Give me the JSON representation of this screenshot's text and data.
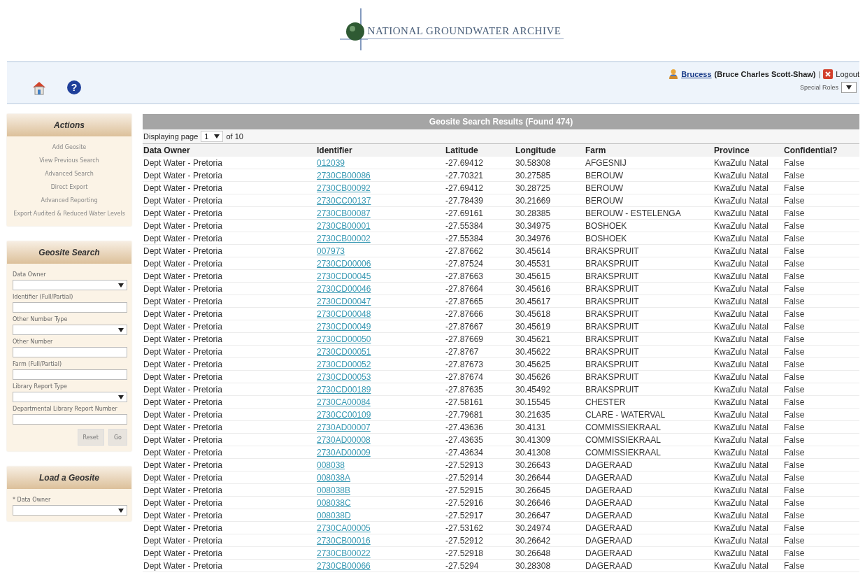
{
  "logo": {
    "text": "NATIONAL GROUNDWATER ARCHIVE"
  },
  "header": {
    "help_glyph": "?",
    "user_link": "Brucess",
    "user_full": "(Bruce Charles Scott-Shaw)",
    "separator": "|",
    "logout": "Logout",
    "special_roles_label": "Special Roles"
  },
  "sidebar": {
    "panels": [
      {
        "title": "Actions",
        "kind": "links",
        "items": [
          "Add Geosite",
          "View Previous Search",
          "Advanced Search",
          "Direct Export",
          "Advanced Reporting",
          "Export Audited & Reduced Water Levels"
        ]
      },
      {
        "title": "Geosite Search",
        "kind": "form",
        "fields": [
          {
            "label": "Data Owner",
            "kind": "select"
          },
          {
            "label": "Identifier (Full/Partial)",
            "kind": "text"
          },
          {
            "label": "Other Number Type",
            "kind": "select"
          },
          {
            "label": "Other Number",
            "kind": "text"
          },
          {
            "label": "Farm (Full/Partial)",
            "kind": "text"
          },
          {
            "label": "Library Report Type",
            "kind": "select"
          },
          {
            "label": "Departmental Library Report Number",
            "kind": "text"
          }
        ],
        "buttons": [
          "Reset",
          "Go"
        ]
      },
      {
        "title": "Load a Geosite",
        "kind": "form",
        "fields": [
          {
            "label": "* Data Owner",
            "kind": "select"
          }
        ]
      }
    ]
  },
  "results": {
    "title": "Geosite Search Results (Found 474)",
    "pager": {
      "prefix": "Displaying page",
      "page": "1",
      "suffix": "of 10"
    },
    "columns": [
      {
        "label": "Data Owner",
        "kind": "text"
      },
      {
        "label": "Identifier",
        "kind": "link"
      },
      {
        "label": "Latitude",
        "kind": "text"
      },
      {
        "label": "Longitude",
        "kind": "text"
      },
      {
        "label": "Farm",
        "kind": "text"
      },
      {
        "label": "Province",
        "kind": "text"
      },
      {
        "label": "Confidential?",
        "kind": "text"
      }
    ],
    "rows": [
      [
        "Dept Water - Pretoria",
        "012039",
        "-27.69412",
        "30.58308",
        "AFGESNIJ",
        "KwaZulu Natal",
        "False"
      ],
      [
        "Dept Water - Pretoria",
        "2730CB00086",
        "-27.70321",
        "30.27585",
        "BEROUW",
        "KwaZulu Natal",
        "False"
      ],
      [
        "Dept Water - Pretoria",
        "2730CB00092",
        "-27.69412",
        "30.28725",
        "BEROUW",
        "KwaZulu Natal",
        "False"
      ],
      [
        "Dept Water - Pretoria",
        "2730CC00137",
        "-27.78439",
        "30.21669",
        "BEROUW",
        "KwaZulu Natal",
        "False"
      ],
      [
        "Dept Water - Pretoria",
        "2730CB00087",
        "-27.69161",
        "30.28385",
        "BEROUW - ESTELENGA",
        "KwaZulu Natal",
        "False"
      ],
      [
        "Dept Water - Pretoria",
        "2730CB00001",
        "-27.55384",
        "30.34975",
        "BOSHOEK",
        "KwaZulu Natal",
        "False"
      ],
      [
        "Dept Water - Pretoria",
        "2730CB00002",
        "-27.55384",
        "30.34976",
        "BOSHOEK",
        "KwaZulu Natal",
        "False"
      ],
      [
        "Dept Water - Pretoria",
        "007973",
        "-27.87662",
        "30.45614",
        "BRAKSPRUIT",
        "KwaZulu Natal",
        "False"
      ],
      [
        "Dept Water - Pretoria",
        "2730CD00006",
        "-27.87524",
        "30.45531",
        "BRAKSPRUIT",
        "KwaZulu Natal",
        "False"
      ],
      [
        "Dept Water - Pretoria",
        "2730CD00045",
        "-27.87663",
        "30.45615",
        "BRAKSPRUIT",
        "KwaZulu Natal",
        "False"
      ],
      [
        "Dept Water - Pretoria",
        "2730CD00046",
        "-27.87664",
        "30.45616",
        "BRAKSPRUIT",
        "KwaZulu Natal",
        "False"
      ],
      [
        "Dept Water - Pretoria",
        "2730CD00047",
        "-27.87665",
        "30.45617",
        "BRAKSPRUIT",
        "KwaZulu Natal",
        "False"
      ],
      [
        "Dept Water - Pretoria",
        "2730CD00048",
        "-27.87666",
        "30.45618",
        "BRAKSPRUIT",
        "KwaZulu Natal",
        "False"
      ],
      [
        "Dept Water - Pretoria",
        "2730CD00049",
        "-27.87667",
        "30.45619",
        "BRAKSPRUIT",
        "KwaZulu Natal",
        "False"
      ],
      [
        "Dept Water - Pretoria",
        "2730CD00050",
        "-27.87669",
        "30.45621",
        "BRAKSPRUIT",
        "KwaZulu Natal",
        "False"
      ],
      [
        "Dept Water - Pretoria",
        "2730CD00051",
        "-27.8767",
        "30.45622",
        "BRAKSPRUIT",
        "KwaZulu Natal",
        "False"
      ],
      [
        "Dept Water - Pretoria",
        "2730CD00052",
        "-27.87673",
        "30.45625",
        "BRAKSPRUIT",
        "KwaZulu Natal",
        "False"
      ],
      [
        "Dept Water - Pretoria",
        "2730CD00053",
        "-27.87674",
        "30.45626",
        "BRAKSPRUIT",
        "KwaZulu Natal",
        "False"
      ],
      [
        "Dept Water - Pretoria",
        "2730CD00189",
        "-27.87635",
        "30.45492",
        "BRAKSPRUIT",
        "KwaZulu Natal",
        "False"
      ],
      [
        "Dept Water - Pretoria",
        "2730CA00084",
        "-27.58161",
        "30.15545",
        "CHESTER",
        "KwaZulu Natal",
        "False"
      ],
      [
        "Dept Water - Pretoria",
        "2730CC00109",
        "-27.79681",
        "30.21635",
        "CLARE - WATERVAL",
        "KwaZulu Natal",
        "False"
      ],
      [
        "Dept Water - Pretoria",
        "2730AD00007",
        "-27.43636",
        "30.4131",
        "COMMISSIEKRAAL",
        "KwaZulu Natal",
        "False"
      ],
      [
        "Dept Water - Pretoria",
        "2730AD00008",
        "-27.43635",
        "30.41309",
        "COMMISSIEKRAAL",
        "KwaZulu Natal",
        "False"
      ],
      [
        "Dept Water - Pretoria",
        "2730AD00009",
        "-27.43634",
        "30.41308",
        "COMMISSIEKRAAL",
        "KwaZulu Natal",
        "False"
      ],
      [
        "Dept Water - Pretoria",
        "008038",
        "-27.52913",
        "30.26643",
        "DAGERAAD",
        "KwaZulu Natal",
        "False"
      ],
      [
        "Dept Water - Pretoria",
        "008038A",
        "-27.52914",
        "30.26644",
        "DAGERAAD",
        "KwaZulu Natal",
        "False"
      ],
      [
        "Dept Water - Pretoria",
        "008038B",
        "-27.52915",
        "30.26645",
        "DAGERAAD",
        "KwaZulu Natal",
        "False"
      ],
      [
        "Dept Water - Pretoria",
        "008038C",
        "-27.52916",
        "30.26646",
        "DAGERAAD",
        "KwaZulu Natal",
        "False"
      ],
      [
        "Dept Water - Pretoria",
        "008038D",
        "-27.52917",
        "30.26647",
        "DAGERAAD",
        "KwaZulu Natal",
        "False"
      ],
      [
        "Dept Water - Pretoria",
        "2730CA00005",
        "-27.53162",
        "30.24974",
        "DAGERAAD",
        "KwaZulu Natal",
        "False"
      ],
      [
        "Dept Water - Pretoria",
        "2730CB00016",
        "-27.52912",
        "30.26642",
        "DAGERAAD",
        "KwaZulu Natal",
        "False"
      ],
      [
        "Dept Water - Pretoria",
        "2730CB00022",
        "-27.52918",
        "30.26648",
        "DAGERAAD",
        "KwaZulu Natal",
        "False"
      ],
      [
        "Dept Water - Pretoria",
        "2730CB00066",
        "-27.5294",
        "30.28308",
        "DAGERAAD",
        "KwaZulu Natal",
        "False"
      ]
    ]
  }
}
